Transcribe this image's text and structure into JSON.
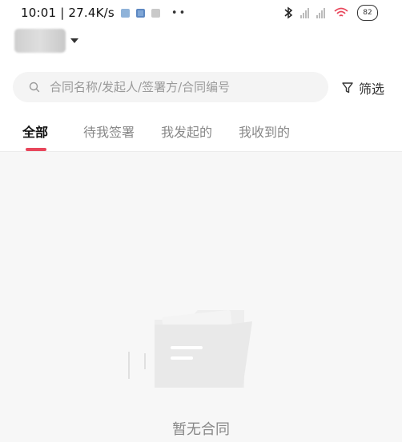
{
  "status_bar": {
    "time_speed": "10:01 | 27.4K/s",
    "dots": "••",
    "battery": "82",
    "icons": [
      "photo-icon",
      "app-icon",
      "image-icon",
      "bluetooth-icon",
      "signal-icon",
      "signal-icon",
      "wifi-icon",
      "battery-icon"
    ]
  },
  "search": {
    "placeholder": "合同名称/发起人/签署方/合同编号"
  },
  "filter": {
    "label": "筛选"
  },
  "tabs": [
    {
      "label": "全部",
      "active": true
    },
    {
      "label": "待我签署",
      "active": false
    },
    {
      "label": "我发起的",
      "active": false
    },
    {
      "label": "我收到的",
      "active": false
    }
  ],
  "empty_state": {
    "text": "暂无合同"
  },
  "colors": {
    "accent": "#e8465b",
    "content_bg": "#f7f7f7",
    "search_bg": "#f4f4f4"
  }
}
